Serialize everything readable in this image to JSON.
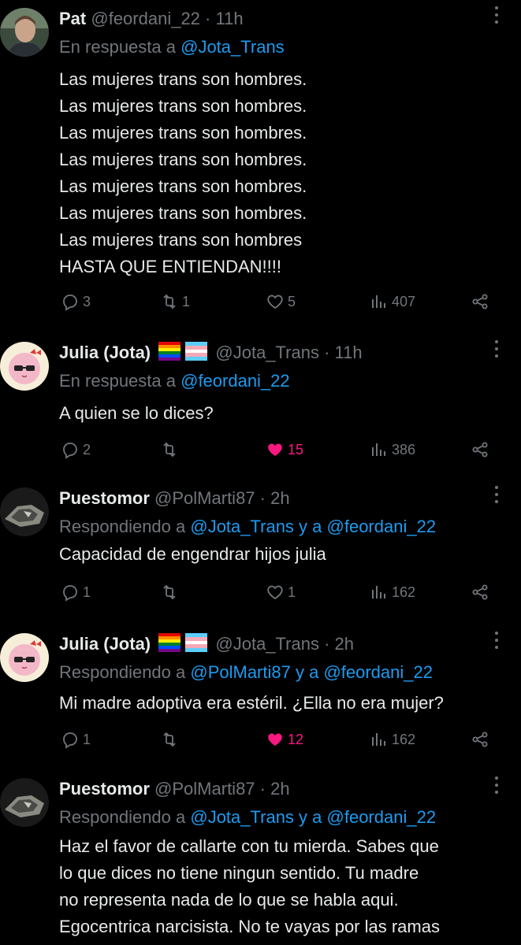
{
  "tweets": [
    {
      "name": "Pat",
      "handle": "@feordani_22",
      "separator": "·",
      "time": "11h",
      "reply_prefix": "En respuesta a ",
      "reply_mentions": "@Jota_Trans",
      "reply_joiner": "",
      "reply_mentions2": "",
      "lines": [
        "Las mujeres trans son hombres.",
        "Las mujeres trans son hombres.",
        "Las mujeres trans son hombres.",
        "Las mujeres trans son hombres.",
        "Las mujeres trans son hombres.",
        "Las mujeres trans son hombres.",
        "Las mujeres trans son hombres",
        "HASTA QUE ENTIENDAN!!!!"
      ],
      "replies": "3",
      "retweets": "1",
      "likes": "5",
      "views": "407",
      "liked": false
    },
    {
      "name": "Julia (Jota)",
      "handle": "@Jota_Trans",
      "separator": "·",
      "time": "11h",
      "reply_prefix": "En respuesta a ",
      "reply_mentions": "@feordani_22",
      "reply_joiner": "",
      "reply_mentions2": "",
      "lines": [
        "A quien se lo dices?"
      ],
      "replies": "2",
      "retweets": "",
      "likes": "15",
      "views": "386",
      "liked": true
    },
    {
      "name": "Puestomor",
      "handle": "@PolMarti87",
      "separator": "·",
      "time": "2h",
      "reply_prefix": "Respondiendo a ",
      "reply_mentions": "@Jota_Trans",
      "reply_joiner": " y a ",
      "reply_mentions2": "@feordani_22",
      "lines": [
        "Capacidad de engendrar hijos julia"
      ],
      "replies": "1",
      "retweets": "",
      "likes": "1",
      "views": "162",
      "liked": false
    },
    {
      "name": "Julia (Jota)",
      "handle": "@Jota_Trans",
      "separator": "·",
      "time": "2h",
      "reply_prefix": "Respondiendo a ",
      "reply_mentions": "@PolMarti87",
      "reply_joiner": " y a ",
      "reply_mentions2": "@feordani_22",
      "lines": [
        "Mi madre adoptiva era estéril. ¿Ella no era mujer?"
      ],
      "replies": "1",
      "retweets": "",
      "likes": "12",
      "views": "162",
      "liked": true
    },
    {
      "name": "Puestomor",
      "handle": "@PolMarti87",
      "separator": "·",
      "time": "2h",
      "reply_prefix": "Respondiendo a ",
      "reply_mentions": "@Jota_Trans",
      "reply_joiner": " y a ",
      "reply_mentions2": "@feordani_22",
      "lines": [
        "Haz el favor de callarte con tu mierda. Sabes que",
        "lo que dices no tiene ningun sentido. Tu madre",
        "no representa nada de lo que se habla aqui.",
        "Egocentrica narcisista. No te vayas por las ramas"
      ],
      "replies": "",
      "retweets": "",
      "likes": "",
      "views": "",
      "liked": false
    }
  ],
  "colors": {
    "background": "#000000",
    "text": "#e7e9ea",
    "muted": "#71767b",
    "link": "#1d9bf0",
    "like": "#f91880"
  },
  "icons": {
    "reply": "reply-icon",
    "retweet": "retweet-icon",
    "like": "heart-icon",
    "views": "views-icon",
    "share": "share-icon",
    "more": "more-icon"
  }
}
